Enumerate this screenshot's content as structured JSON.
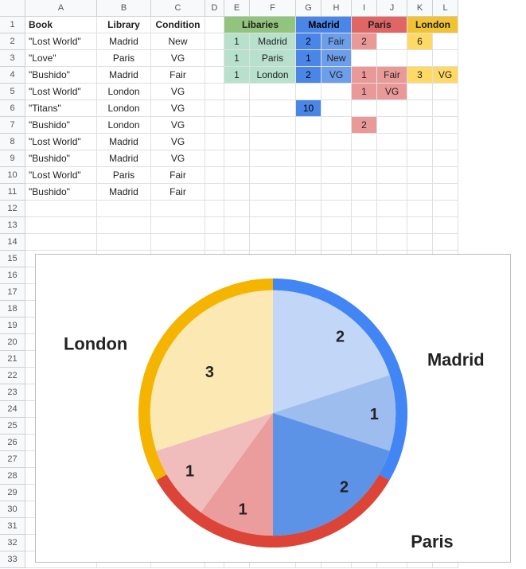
{
  "columns": [
    "A",
    "B",
    "C",
    "D",
    "E",
    "F",
    "G",
    "H",
    "I",
    "J",
    "K",
    "L"
  ],
  "row_count": 33,
  "headers": {
    "A": "Book",
    "B": "Library",
    "C": "Condition"
  },
  "table": [
    {
      "A": "\"Lost World\"",
      "B": "Madrid",
      "C": "New"
    },
    {
      "A": "\"Love\"",
      "B": "Paris",
      "C": "VG"
    },
    {
      "A": "\"Bushido\"",
      "B": "Madrid",
      "C": "Fair"
    },
    {
      "A": "\"Lost World\"",
      "B": "London",
      "C": "VG"
    },
    {
      "A": "\"Titans\"",
      "B": "London",
      "C": "VG"
    },
    {
      "A": "\"Bushido\"",
      "B": "London",
      "C": "VG"
    },
    {
      "A": "\"Lost World\"",
      "B": "Madrid",
      "C": "VG"
    },
    {
      "A": "\"Bushido\"",
      "B": "Madrid",
      "C": "VG"
    },
    {
      "A": "\"Lost World\"",
      "B": "Paris",
      "C": "Fair"
    },
    {
      "A": "\"Bushido\"",
      "B": "Madrid",
      "C": "Fair"
    }
  ],
  "summary_headers": {
    "lib": "Libaries",
    "madrid": "Madrid",
    "paris": "Paris",
    "london": "London"
  },
  "summary": {
    "r2": {
      "E": "1",
      "F": "Madrid",
      "G": "2",
      "H": "Fair",
      "I": "2",
      "K": "6"
    },
    "r3": {
      "E": "1",
      "F": "Paris",
      "G": "1",
      "H": "New"
    },
    "r4": {
      "E": "1",
      "F": "London",
      "G": "2",
      "H": "VG",
      "I": "1",
      "J": "Fair",
      "K": "3",
      "L": "VG"
    },
    "r5": {
      "I": "1",
      "J": "VG"
    },
    "r6": {
      "G": "10"
    },
    "r7": {
      "I": "2"
    }
  },
  "chart_data": {
    "type": "pie",
    "title": "",
    "series": [
      {
        "name": "Madrid",
        "color": "#4a86e8",
        "slices": [
          {
            "label": "2",
            "value": 2,
            "shade": "#c2d6f7"
          },
          {
            "label": "1",
            "value": 1,
            "shade": "#9dbdee"
          },
          {
            "label": "2",
            "value": 2,
            "shade": "#5c93e6"
          }
        ]
      },
      {
        "name": "Paris",
        "color": "#e06666",
        "slices": [
          {
            "label": "1",
            "value": 1,
            "shade": "#eb9c9c"
          },
          {
            "label": "1",
            "value": 1,
            "shade": "#f1bcbc"
          }
        ]
      },
      {
        "name": "London",
        "color": "#f1c232",
        "slices": [
          {
            "label": "3",
            "value": 3,
            "shade": "#fce8b2"
          }
        ]
      }
    ],
    "labels": {
      "madrid": "Madrid",
      "paris": "Paris",
      "london": "London"
    }
  }
}
